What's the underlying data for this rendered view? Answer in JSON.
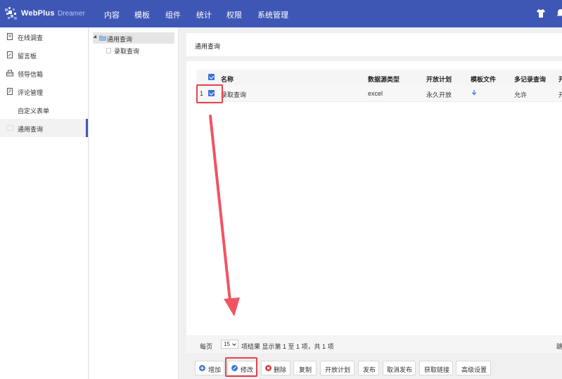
{
  "app": {
    "brand": "WebPlus",
    "sub_brand": "Dreamer"
  },
  "topnav": {
    "items": [
      "内容",
      "模板",
      "组件",
      "统计",
      "权限",
      "系统管理"
    ]
  },
  "sidebar": {
    "items": [
      {
        "label": "在线调查",
        "icon": "survey-icon"
      },
      {
        "label": "留言板",
        "icon": "message-board-icon"
      },
      {
        "label": "领导信箱",
        "icon": "mailbox-icon"
      },
      {
        "label": "评论管理",
        "icon": "comment-icon"
      },
      {
        "label": "自定义表单",
        "icon": ""
      },
      {
        "label": "通用查询",
        "icon": "query-icon",
        "active": true
      }
    ]
  },
  "tree": {
    "root": "通用查询",
    "child": "录取查询"
  },
  "panel": {
    "title": "通用查询"
  },
  "grid": {
    "columns": [
      "名称",
      "数据源类型",
      "开放计划",
      "模板文件",
      "多记录查询",
      "开"
    ],
    "rows": [
      {
        "index": "1",
        "name": "录取查询",
        "source": "excel",
        "plan": "永久开放",
        "template": "download-icon",
        "multi": "允许",
        "status": "开",
        "checked": true
      }
    ]
  },
  "pager": {
    "per_page_label": "每页",
    "per_page": "15",
    "summary": "项结果 显示第 1 至 1 项，共 1 项",
    "right": "跳"
  },
  "toolbar": {
    "add": "增加",
    "edit": "修改",
    "delete": "删除",
    "copy": "复制",
    "open_plan": "开放计划",
    "publish": "发布",
    "unpublish": "取消发布",
    "get_link": "获取链接",
    "advanced": "高级设置"
  },
  "colors": {
    "header": "#3e57b5",
    "accent": "#3a73d6",
    "highlight": "#e8404a",
    "add_icon": "#3a73d6",
    "edit_icon": "#3a73d6",
    "delete_icon": "#d9363e",
    "status_text": "#4caa3d"
  }
}
